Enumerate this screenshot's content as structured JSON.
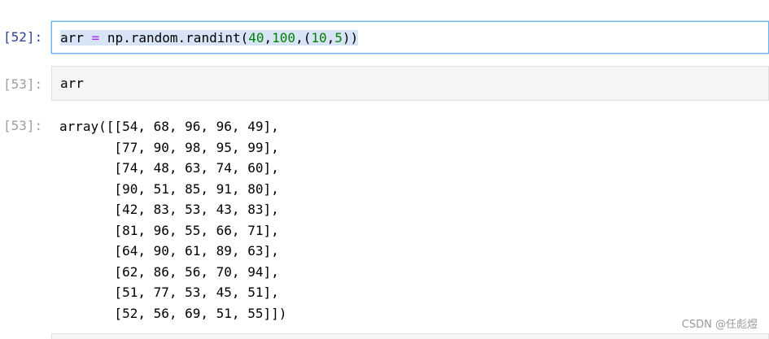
{
  "cells": [
    {
      "prompt": "[52]:",
      "code_tokens": [
        {
          "text": "arr",
          "cls": "tok-var"
        },
        {
          "text": " ",
          "cls": "tok-var"
        },
        {
          "text": "=",
          "cls": "tok-op"
        },
        {
          "text": " np",
          "cls": "tok-var"
        },
        {
          "text": ".",
          "cls": "tok-punct"
        },
        {
          "text": "random",
          "cls": "tok-var"
        },
        {
          "text": ".",
          "cls": "tok-punct"
        },
        {
          "text": "randint",
          "cls": "tok-var"
        },
        {
          "text": "(",
          "cls": "tok-punct"
        },
        {
          "text": "40",
          "cls": "tok-num"
        },
        {
          "text": ",",
          "cls": "tok-punct"
        },
        {
          "text": "100",
          "cls": "tok-num"
        },
        {
          "text": ",(",
          "cls": "tok-punct"
        },
        {
          "text": "10",
          "cls": "tok-num"
        },
        {
          "text": ",",
          "cls": "tok-punct"
        },
        {
          "text": "5",
          "cls": "tok-num"
        },
        {
          "text": "))",
          "cls": "tok-punct"
        }
      ]
    },
    {
      "prompt": "[53]:",
      "code": "arr"
    }
  ],
  "output": {
    "prompt": "[53]:",
    "lines": [
      "array([[54, 68, 96, 96, 49],",
      "       [77, 90, 98, 95, 99],",
      "       [74, 48, 63, 74, 60],",
      "       [90, 51, 85, 91, 80],",
      "       [42, 83, 53, 43, 83],",
      "       [81, 96, 55, 66, 71],",
      "       [64, 90, 61, 89, 63],",
      "       [62, 86, 56, 70, 94],",
      "       [51, 77, 53, 45, 51],",
      "       [52, 56, 69, 51, 55]])"
    ]
  },
  "watermark": "CSDN @任彪煜"
}
